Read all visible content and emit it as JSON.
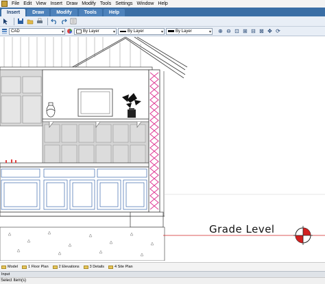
{
  "menu": [
    "File",
    "Edit",
    "View",
    "Insert",
    "Draw",
    "Modify",
    "Tools",
    "Settings",
    "Window",
    "Help"
  ],
  "ribbon_tabs": [
    "Insert",
    "Draw",
    "Modify",
    "Tools",
    "Help"
  ],
  "active_ribbon_tab": "Insert",
  "toolbar": {
    "layer_value": "CAD",
    "color_value": "By Layer",
    "linetype_value": "By Layer",
    "lineweight_value": "By Layer"
  },
  "drawing": {
    "grade_label": "Grade Level"
  },
  "layout_tabs": [
    "Model",
    "1 Floor Plan",
    "2 Elevations",
    "3 Details",
    "4 Site Plan"
  ],
  "input_label": "Input",
  "status_text": "Select Item(s)",
  "colors": {
    "ribbon_bg": "#3a6ea5",
    "insulation": "#e0449a",
    "grade_line": "#d22020"
  }
}
